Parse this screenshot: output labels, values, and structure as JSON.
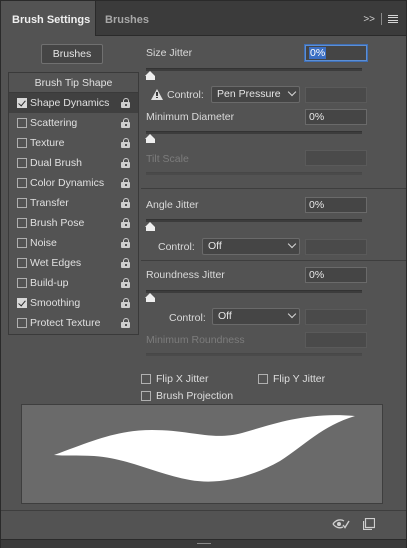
{
  "tabs": [
    {
      "label": "Brush Settings"
    },
    {
      "label": "Brushes"
    }
  ],
  "header_tools": {
    "collapse_glyph": ">>",
    "menu_icon": "hamburger-menu-icon"
  },
  "brushes_button": "Brushes",
  "brush_list": {
    "header": "Brush Tip Shape",
    "items": [
      {
        "label": "Shape Dynamics",
        "checked": true,
        "selected": true
      },
      {
        "label": "Scattering",
        "checked": false
      },
      {
        "label": "Texture",
        "checked": false
      },
      {
        "label": "Dual Brush",
        "checked": false
      },
      {
        "label": "Color Dynamics",
        "checked": false
      },
      {
        "label": "Transfer",
        "checked": false
      },
      {
        "label": "Brush Pose",
        "checked": false
      },
      {
        "label": "Noise",
        "checked": false
      },
      {
        "label": "Wet Edges",
        "checked": false
      },
      {
        "label": "Build-up",
        "checked": false
      },
      {
        "label": "Smoothing",
        "checked": true
      },
      {
        "label": "Protect Texture",
        "checked": false
      }
    ]
  },
  "size_jitter": {
    "label": "Size Jitter",
    "value": "0%"
  },
  "size_control": {
    "label": "Control:",
    "value": "Pen Pressure",
    "icon": "warning-icon"
  },
  "minimum_diameter": {
    "label": "Minimum Diameter",
    "value": "0%"
  },
  "tilt_scale": {
    "label": "Tilt Scale",
    "value": ""
  },
  "angle_jitter": {
    "label": "Angle Jitter",
    "value": "0%"
  },
  "angle_control": {
    "label": "Control:",
    "value": "Off"
  },
  "roundness_jitter": {
    "label": "Roundness Jitter",
    "value": "0%"
  },
  "roundness_control": {
    "label": "Control:",
    "value": "Off"
  },
  "minimum_roundness": {
    "label": "Minimum Roundness",
    "value": ""
  },
  "options": {
    "flip_x": {
      "label": "Flip X Jitter",
      "checked": false
    },
    "flip_y": {
      "label": "Flip Y Jitter",
      "checked": false
    },
    "brush_projection": {
      "label": "Brush Projection",
      "checked": false
    }
  },
  "footer_icons": [
    "eye-toggle-icon",
    "new-preset-icon"
  ],
  "colors": {
    "panel": "#535353",
    "tabbar": "#3b3b3b",
    "focus": "#5c8fd6",
    "preview": "#6a6a6a",
    "stroke": "#ffffff"
  }
}
